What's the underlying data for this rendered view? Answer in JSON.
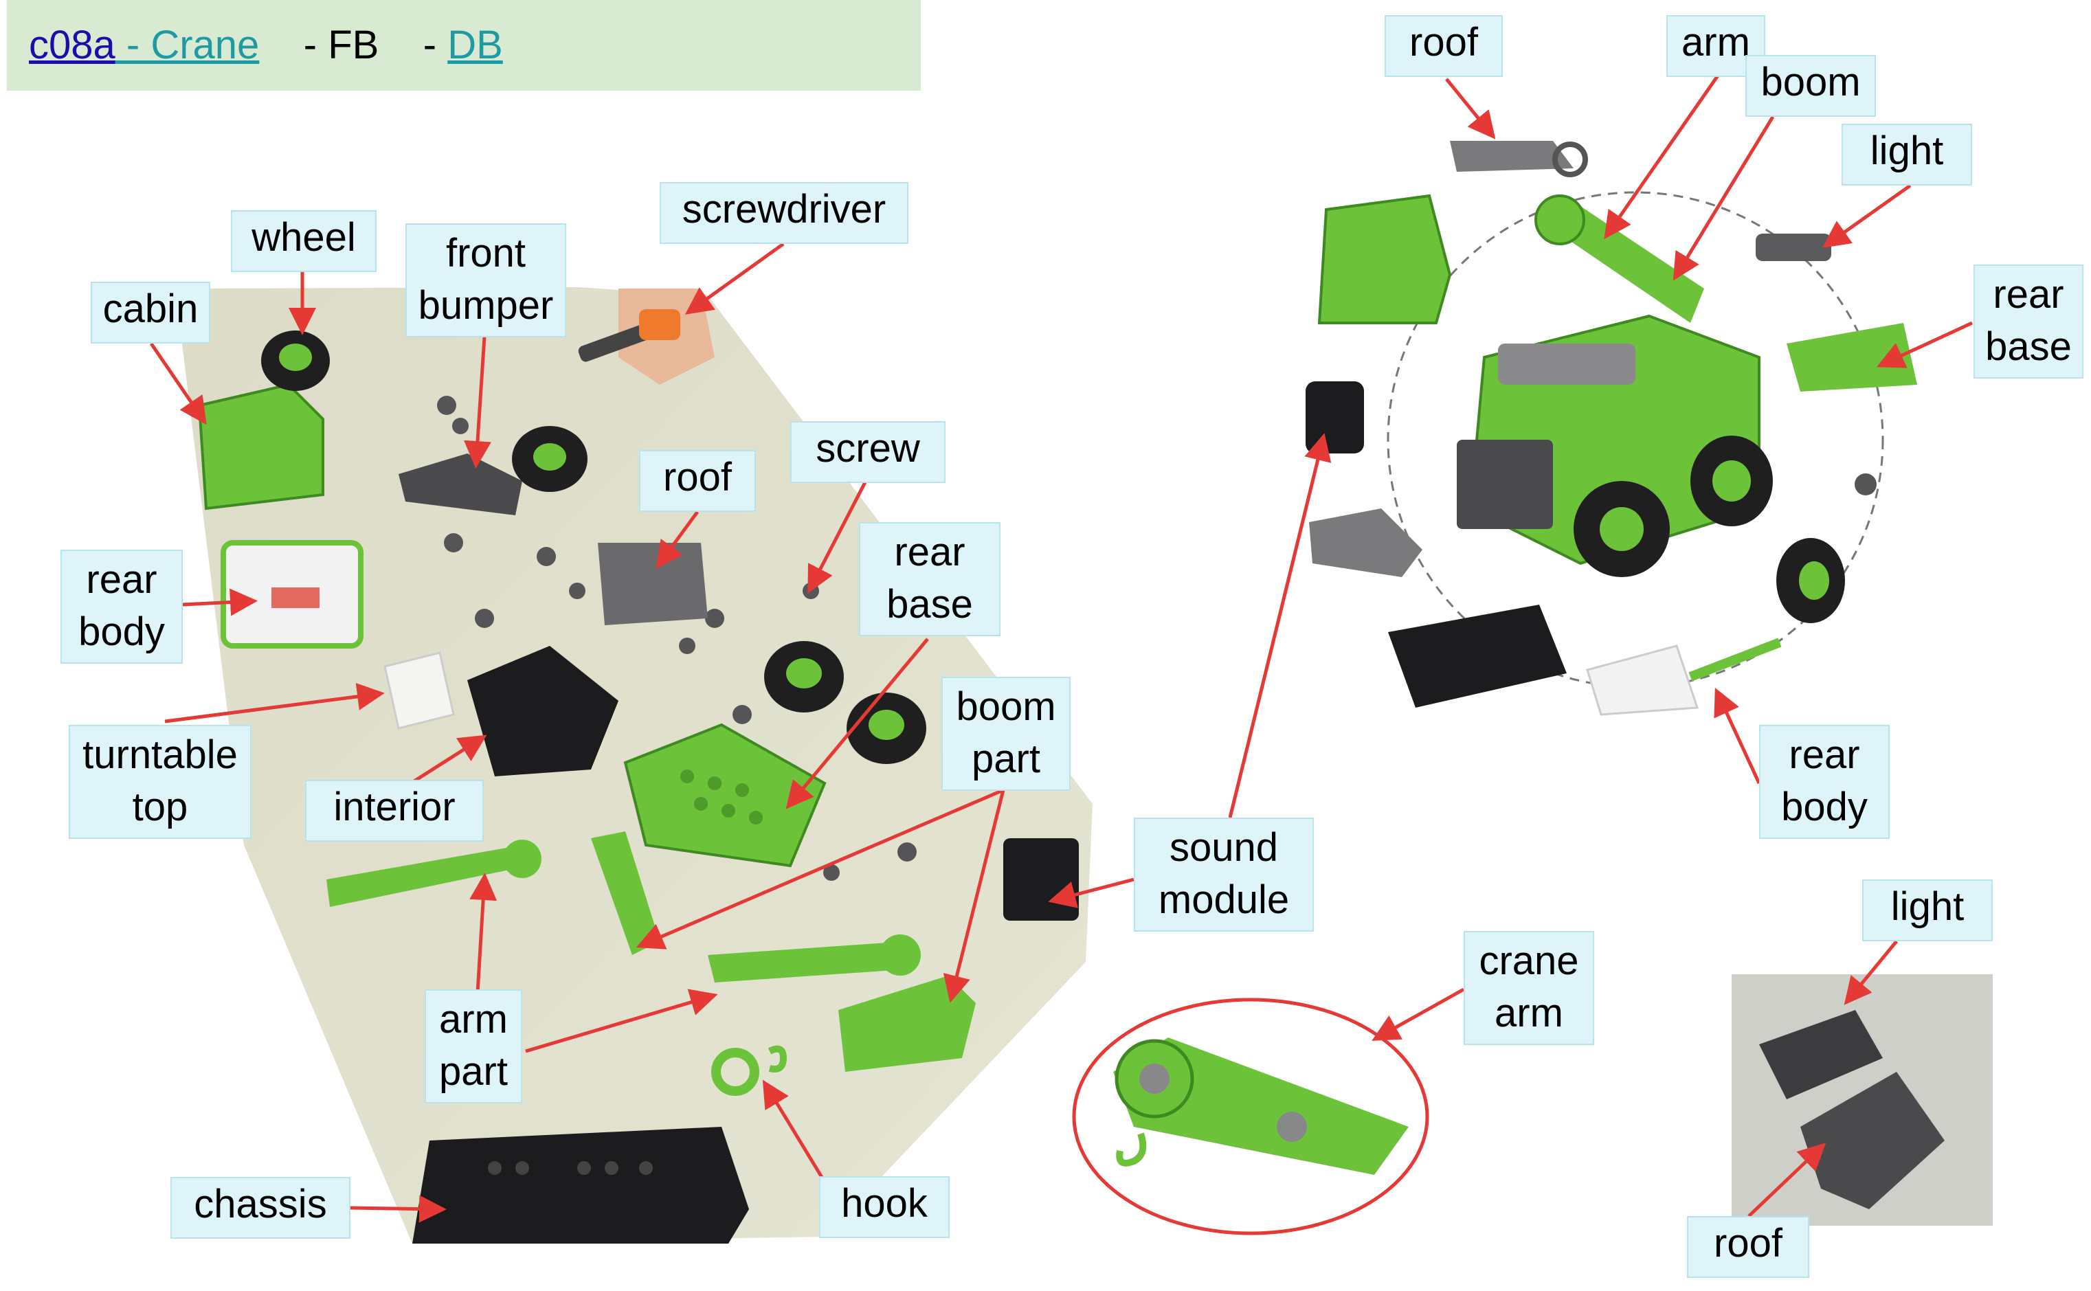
{
  "header": {
    "id_link": "c08a",
    "title_link": " - Crane",
    "fb": "- FB",
    "dash": "-",
    "db_link": "DB"
  },
  "labels": {
    "wheel": "wheel",
    "cabin": "cabin",
    "front_bumper_1": "front",
    "front_bumper_2": "bumper",
    "screwdriver": "screwdriver",
    "roof_left": "roof",
    "screw": "screw",
    "rear_base_left_1": "rear",
    "rear_base_left_2": "base",
    "rear_body_left_1": "rear",
    "rear_body_left_2": "body",
    "boom_part_1": "boom",
    "boom_part_2": "part",
    "turntable_top_1": "turntable",
    "turntable_top_2": "top",
    "interior": "interior",
    "arm_part_1": "arm",
    "arm_part_2": "part",
    "chassis": "chassis",
    "hook": "hook",
    "sound_module_1": "sound",
    "sound_module_2": "module",
    "crane_arm_1": "crane",
    "crane_arm_2": "arm",
    "roof_top": "roof",
    "arm_top": "arm",
    "boom_top": "boom",
    "light_top": "light",
    "rear_base_right_1": "rear",
    "rear_base_right_2": "base",
    "rear_body_right_1": "rear",
    "rear_body_right_2": "body",
    "light_bottom": "light",
    "roof_bottom": "roof"
  },
  "colors": {
    "header_bg": "#d9ead3",
    "label_bg": "#dff4f8",
    "label_border": "#b8e3ec",
    "arrow": "#e53935",
    "part_green": "#6cc33a",
    "part_dark": "#3b3b3d",
    "part_gray": "#7a7a7d"
  }
}
